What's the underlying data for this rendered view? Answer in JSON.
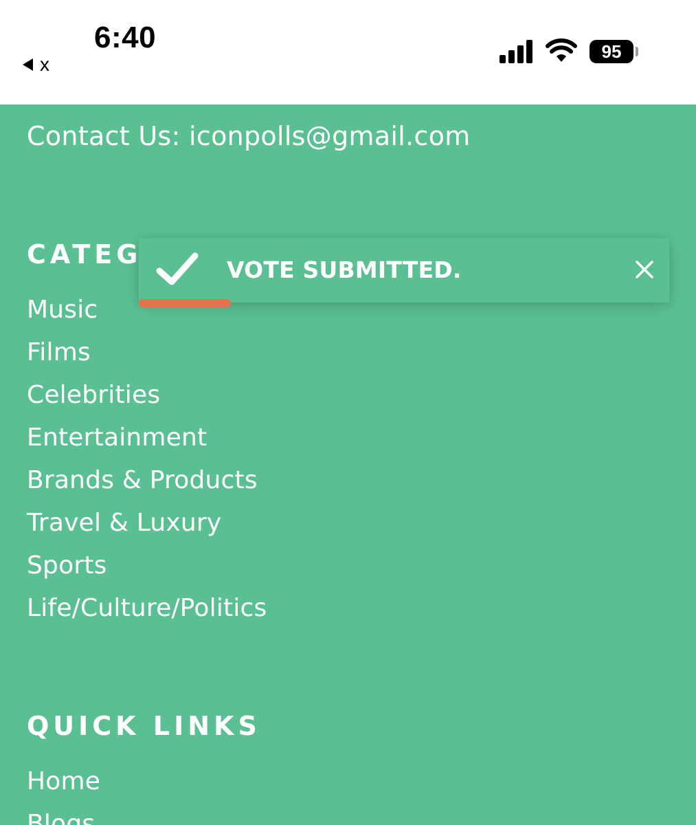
{
  "status_bar": {
    "time": "6:40",
    "back_label": "x",
    "battery_level": "95",
    "signal_bars": 4,
    "icons": [
      "back-triangle-icon",
      "signal-icon",
      "wifi-icon",
      "battery-icon"
    ]
  },
  "footer": {
    "contact_text": "Contact Us: iconpolls@gmail.com",
    "categories": {
      "heading": "CATEG",
      "items": [
        "Music",
        "Films",
        "Celebrities",
        "Entertainment",
        "Brands & Products",
        "Travel & Luxury",
        "Sports",
        "Life/Culture/Politics"
      ]
    },
    "quick_links": {
      "heading": "QUICK LINKS",
      "items": [
        "Home",
        "Blogs"
      ]
    }
  },
  "toast": {
    "message": "VOTE SUBMITTED.",
    "icon": "checkmark-icon",
    "close_icon": "close-icon"
  },
  "colors": {
    "background": "#5ac094",
    "text": "#ffffff",
    "progress": "#e8704f",
    "status_bar_bg": "#ffffff"
  }
}
